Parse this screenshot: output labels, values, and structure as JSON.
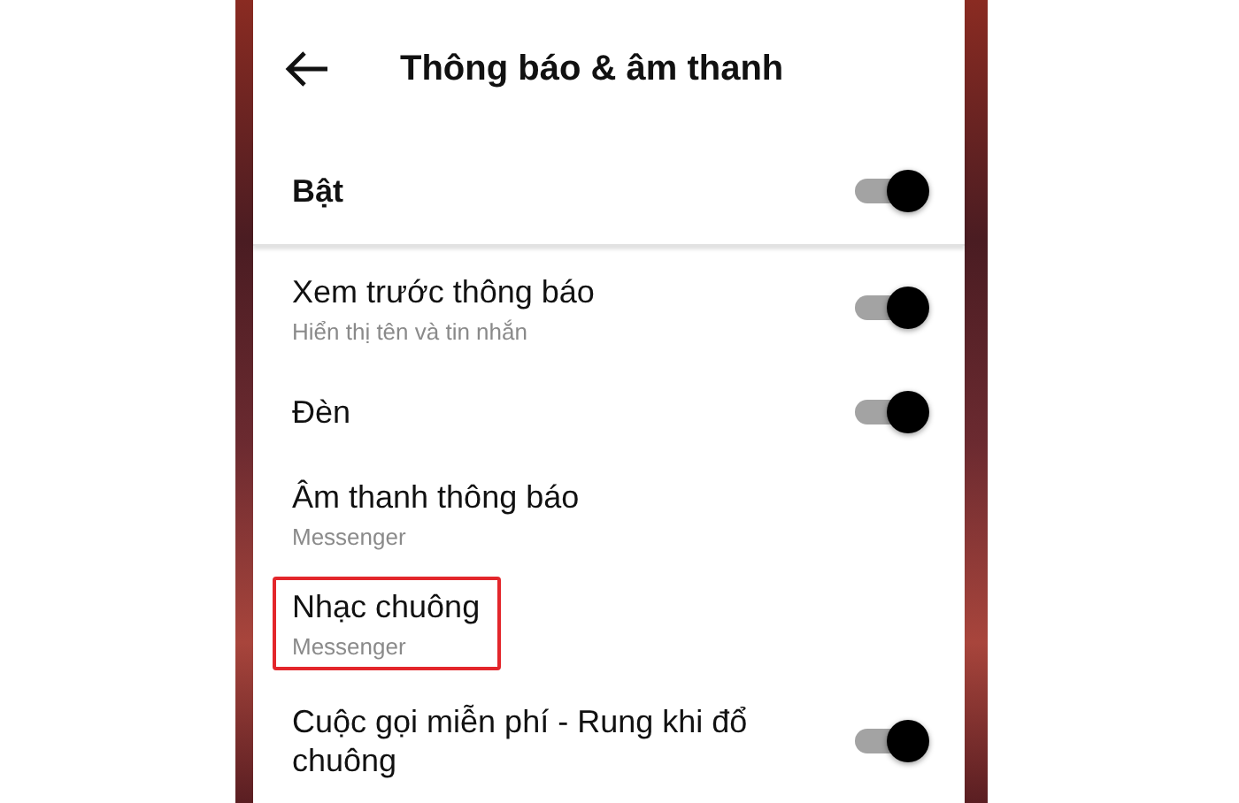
{
  "header": {
    "title": "Thông báo & âm thanh"
  },
  "master": {
    "label": "Bật",
    "on": true
  },
  "items": [
    {
      "kind": "toggle",
      "title": "Xem trước thông báo",
      "subtitle": "Hiển thị tên và tin nhắn",
      "on": true,
      "highlighted": false
    },
    {
      "kind": "toggle",
      "title": "Đèn",
      "on": true,
      "highlighted": false
    },
    {
      "kind": "plain",
      "title": "Âm thanh thông báo",
      "subtitle": "Messenger",
      "highlighted": false
    },
    {
      "kind": "plain",
      "title": "Nhạc chuông",
      "subtitle": "Messenger",
      "highlighted": true
    },
    {
      "kind": "toggle",
      "title": "Cuộc gọi miễn phí - Rung khi đổ chuông",
      "on": true,
      "highlighted": false
    }
  ]
}
